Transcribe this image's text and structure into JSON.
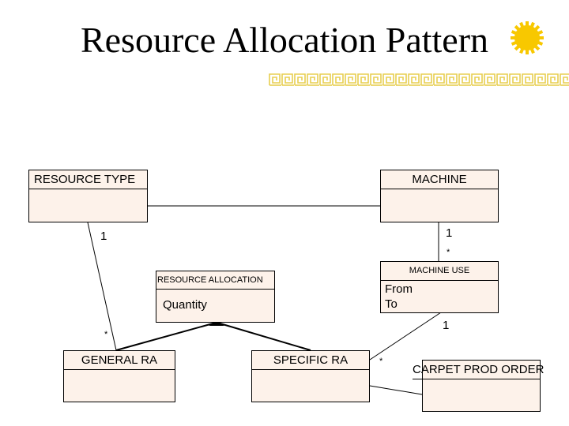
{
  "title": "Resource Allocation Pattern",
  "decorations": {
    "sun_icon_color": "#f8c800",
    "greek_key_color": "#e8cf50"
  },
  "classes": {
    "resource_type": {
      "name": "RESOURCE TYPE",
      "attributes": ""
    },
    "machine": {
      "name": "MACHINE",
      "attributes": ""
    },
    "resource_allocation": {
      "name": "RESOURCE ALLOCATION",
      "attributes": "Quantity"
    },
    "machine_use": {
      "name": "MACHINE USE",
      "attributes": "From\nTo"
    },
    "general_ra": {
      "name": "GENERAL RA",
      "attributes": ""
    },
    "specific_ra": {
      "name": "SPECIFIC RA",
      "attributes": ""
    },
    "carpet_prod_order": {
      "name": "CARPET PROD ORDER",
      "attributes": ""
    }
  },
  "multiplicities": {
    "resource_type_to_general_ra_top": "1",
    "resource_type_to_general_ra_bottom": "*",
    "machine_to_machine_use_top": "1",
    "machine_to_machine_use_bottom": "*",
    "machine_use_to_specific_ra_top": "1",
    "machine_use_to_specific_ra_bottom": "*"
  },
  "colors": {
    "class_fill": "#fdf2ea",
    "line": "#000000"
  }
}
